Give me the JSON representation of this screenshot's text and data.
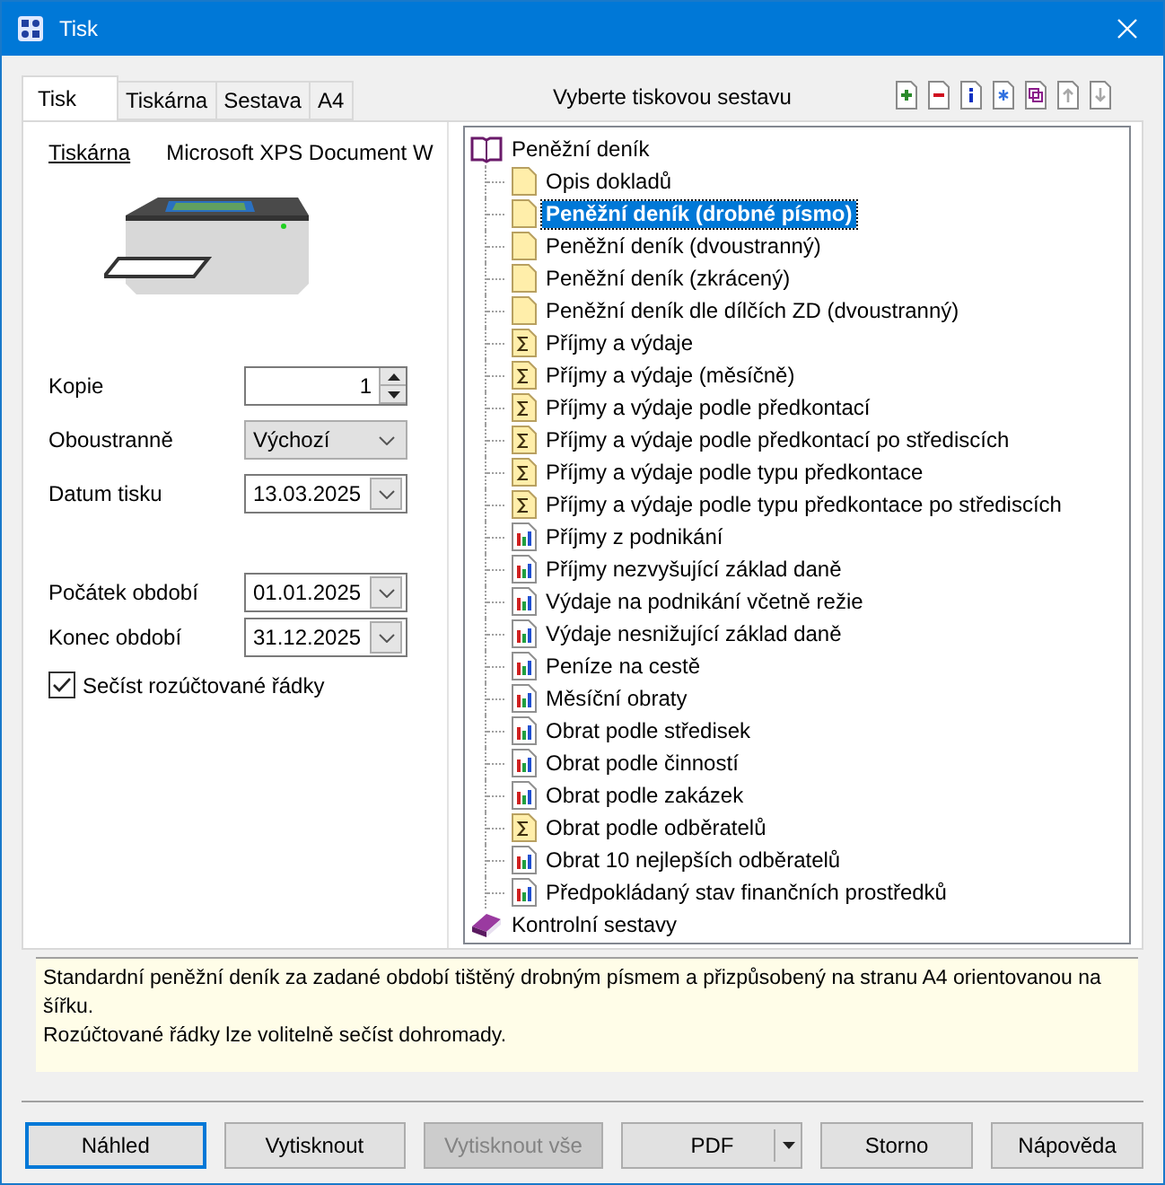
{
  "window": {
    "title": "Tisk"
  },
  "tabs": [
    {
      "label": "Tisk",
      "selected": true
    },
    {
      "label": "Tiskárna",
      "selected": false
    },
    {
      "label": "Sestava",
      "selected": false
    },
    {
      "label": "A4",
      "selected": false
    }
  ],
  "report_header": "Vyberte tiskovou sestavu",
  "toolbar": [
    {
      "kind": "add",
      "disabled": false
    },
    {
      "kind": "remove",
      "disabled": false
    },
    {
      "kind": "info",
      "disabled": false
    },
    {
      "kind": "asterisk",
      "disabled": false
    },
    {
      "kind": "copy",
      "disabled": false
    },
    {
      "kind": "up",
      "disabled": true
    },
    {
      "kind": "down",
      "disabled": true
    }
  ],
  "printer": {
    "link": "Tiskárna",
    "name": "Microsoft XPS Document W"
  },
  "print_fields": [
    {
      "kind": "spin",
      "label": "Kopie",
      "value": "1"
    },
    {
      "kind": "dropdown",
      "label": "Oboustranně",
      "value": "Výchozí"
    },
    {
      "kind": "date",
      "label": "Datum tisku",
      "value": "13.03.2025"
    }
  ],
  "period_fields": [
    {
      "kind": "date",
      "label": "Počátek období",
      "value": "01.01.2025"
    },
    {
      "kind": "date",
      "label": "Konec období",
      "value": "31.12.2025"
    }
  ],
  "sum_checkbox": {
    "label": "Sečíst rozúčtované řádky",
    "checked": true
  },
  "tree": [
    {
      "label": "Peněžní deník",
      "expanded": true,
      "children": [
        {
          "label": "Opis dokladů",
          "kind": "doc",
          "selected": false
        },
        {
          "label": "Peněžní deník (drobné písmo)",
          "kind": "doc",
          "selected": true
        },
        {
          "label": "Peněžní deník (dvoustranný)",
          "kind": "doc",
          "selected": false
        },
        {
          "label": "Peněžní deník (zkrácený)",
          "kind": "doc",
          "selected": false
        },
        {
          "label": "Peněžní deník dle dílčích ZD (dvoustranný)",
          "kind": "doc",
          "selected": false
        },
        {
          "label": "Příjmy a výdaje",
          "kind": "sum",
          "selected": false
        },
        {
          "label": "Příjmy a výdaje (měsíčně)",
          "kind": "sum",
          "selected": false
        },
        {
          "label": "Příjmy a výdaje podle předkontací",
          "kind": "sum",
          "selected": false
        },
        {
          "label": "Příjmy a výdaje podle předkontací po střediscích",
          "kind": "sum",
          "selected": false
        },
        {
          "label": "Příjmy a výdaje podle typu předkontace",
          "kind": "sum",
          "selected": false
        },
        {
          "label": "Příjmy a výdaje podle typu předkontace po střediscích",
          "kind": "sum",
          "selected": false
        },
        {
          "label": "Příjmy z podnikání",
          "kind": "chart",
          "selected": false
        },
        {
          "label": "Příjmy nezvyšující základ daně",
          "kind": "chart",
          "selected": false
        },
        {
          "label": "Výdaje na podnikání včetně režie",
          "kind": "chart",
          "selected": false
        },
        {
          "label": "Výdaje nesnižující základ daně",
          "kind": "chart",
          "selected": false
        },
        {
          "label": "Peníze na cestě",
          "kind": "chart",
          "selected": false
        },
        {
          "label": "Měsíční obraty",
          "kind": "chart",
          "selected": false
        },
        {
          "label": "Obrat podle středisek",
          "kind": "chart",
          "selected": false
        },
        {
          "label": "Obrat podle činností",
          "kind": "chart",
          "selected": false
        },
        {
          "label": "Obrat podle zakázek",
          "kind": "chart",
          "selected": false
        },
        {
          "label": "Obrat podle odběratelů",
          "kind": "sum",
          "selected": false
        },
        {
          "label": "Obrat 10 nejlepších odběratelů",
          "kind": "chart",
          "selected": false
        },
        {
          "label": "Předpokládaný stav finančních prostředků",
          "kind": "chart",
          "selected": false
        }
      ]
    },
    {
      "label": "Kontrolní sestavy",
      "expanded": false
    }
  ],
  "description": [
    "Standardní peněžní deník za zadané období tištěný drobným písmem a přizpůsobený na stranu A4 orientovanou na šířku.",
    "Rozúčtované řádky lze volitelně sečíst dohromady."
  ],
  "buttons": [
    {
      "label": "Náhled",
      "kind": "default",
      "disabled": false
    },
    {
      "label": "Vytisknout",
      "kind": "normal",
      "disabled": false
    },
    {
      "label": "Vytisknout vše",
      "kind": "normal",
      "disabled": true
    },
    {
      "label": "PDF",
      "kind": "split",
      "disabled": false
    },
    {
      "label": "Storno",
      "kind": "normal",
      "disabled": false
    },
    {
      "label": "Nápověda",
      "kind": "normal",
      "disabled": false
    }
  ]
}
